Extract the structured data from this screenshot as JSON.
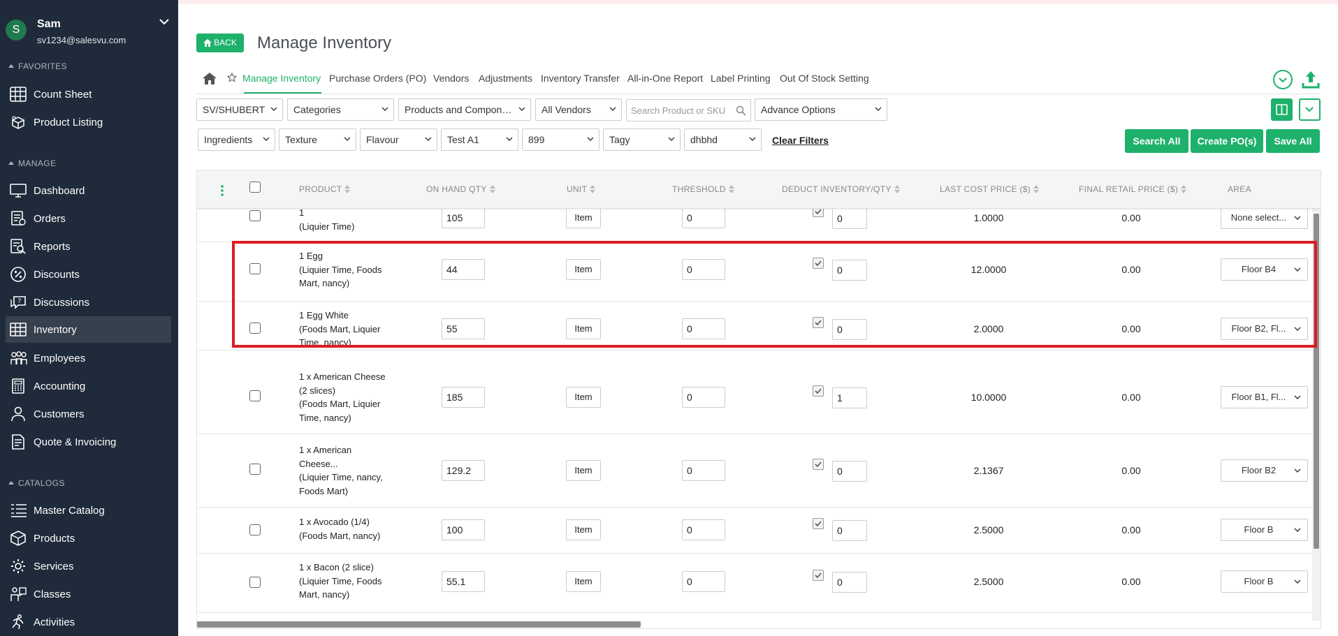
{
  "user": {
    "initial": "S",
    "name": "Sam",
    "email": "sv1234@salesvu.com"
  },
  "sidebar": {
    "favorites_label": "FAVORITES",
    "favorites": [
      {
        "label": "Count Sheet",
        "icon": "grid-table-icon"
      },
      {
        "label": "Product Listing",
        "icon": "boxes-icon"
      }
    ],
    "manage_label": "MANAGE",
    "manage": [
      {
        "label": "Dashboard",
        "icon": "monitor-icon"
      },
      {
        "label": "Orders",
        "icon": "receipt-icon"
      },
      {
        "label": "Reports",
        "icon": "report-icon"
      },
      {
        "label": "Discounts",
        "icon": "percent-icon"
      },
      {
        "label": "Discussions",
        "icon": "chat-icon"
      },
      {
        "label": "Inventory",
        "icon": "inventory-icon",
        "active": true
      },
      {
        "label": "Employees",
        "icon": "people-icon"
      },
      {
        "label": "Accounting",
        "icon": "calculator-icon"
      },
      {
        "label": "Customers",
        "icon": "customer-icon"
      },
      {
        "label": "Quote & Invoicing",
        "icon": "invoice-icon"
      }
    ],
    "catalogs_label": "CATALOGS",
    "catalogs": [
      {
        "label": "Master Catalog",
        "icon": "list-icon"
      },
      {
        "label": "Products",
        "icon": "box-icon"
      },
      {
        "label": "Services",
        "icon": "gear-icon"
      },
      {
        "label": "Classes",
        "icon": "classes-icon"
      },
      {
        "label": "Activities",
        "icon": "activity-icon"
      }
    ]
  },
  "header": {
    "back_label": "BACK",
    "title": "Manage Inventory"
  },
  "tabs": [
    {
      "label": "Manage Inventory",
      "active": true
    },
    {
      "label": "Purchase Orders (PO)"
    },
    {
      "label": "Vendors"
    },
    {
      "label": "Adjustments"
    },
    {
      "label": "Inventory Transfer"
    },
    {
      "label": "All-in-One Report"
    },
    {
      "label": "Label Printing"
    },
    {
      "label": "Out Of Stock Setting"
    }
  ],
  "filters": {
    "location": "SV/SHUBERT",
    "categories": "Categories",
    "products": "Products and Compone...",
    "vendors": "All Vendors",
    "search_placeholder": "Search Product or SKU",
    "advance": "Advance Options",
    "ingredients": "Ingredients",
    "texture": "Texture",
    "flavour": "Flavour",
    "test": "Test A1",
    "num": "899",
    "tagy": "Tagy",
    "dhbhd": "dhbhd",
    "clear": "Clear Filters"
  },
  "actions": {
    "search_all": "Search All",
    "create_po": "Create PO(s)",
    "save_all": "Save All"
  },
  "columns": {
    "product": "PRODUCT",
    "onhand": "ON HAND QTY",
    "unit": "UNIT",
    "threshold": "THRESHOLD",
    "deduct": "DEDUCT INVENTORY/QTY",
    "lastcost": "LAST COST PRICE ($)",
    "retail": "FINAL RETAIL PRICE ($)",
    "area": "AREA"
  },
  "rows": [
    {
      "name": "1",
      "cats": "(Liquier Time)",
      "onhand": "105",
      "unit": "Item",
      "threshold": "0",
      "deduct": "0",
      "lastcost": "1.0000",
      "retail": "0.00",
      "area": "None select..."
    },
    {
      "name": "1 Egg",
      "cats": "(Liquier Time, Foods Mart, nancy)",
      "onhand": "44",
      "unit": "Item",
      "threshold": "0",
      "deduct": "0",
      "lastcost": "12.0000",
      "retail": "0.00",
      "area": "Floor B4"
    },
    {
      "name": "1 Egg White",
      "cats": "(Foods Mart, Liquier Time, nancy)",
      "onhand": "55",
      "unit": "Item",
      "threshold": "0",
      "deduct": "0",
      "lastcost": "2.0000",
      "retail": "0.00",
      "area": "Floor B2, Fl..."
    },
    {
      "name": "1 x American Cheese (2 slices)",
      "cats": "(Foods Mart, Liquier Time, nancy)",
      "onhand": "185",
      "unit": "Item",
      "threshold": "0",
      "deduct": "1",
      "lastcost": "10.0000",
      "retail": "0.00",
      "area": "Floor B1, Fl..."
    },
    {
      "name": "1 x American Cheese...",
      "cats": "(Liquier Time, nancy, Foods Mart)",
      "onhand": "129.2",
      "unit": "Item",
      "threshold": "0",
      "deduct": "0",
      "lastcost": "2.1367",
      "retail": "0.00",
      "area": "Floor B2"
    },
    {
      "name": "1 x Avocado (1/4)",
      "cats": "(Foods Mart, nancy)",
      "onhand": "100",
      "unit": "Item",
      "threshold": "0",
      "deduct": "0",
      "lastcost": "2.5000",
      "retail": "0.00",
      "area": "Floor B"
    },
    {
      "name": "1 x Bacon (2 slice)",
      "cats": "(Liquier Time, Foods Mart, nancy)",
      "onhand": "55.1",
      "unit": "Item",
      "threshold": "0",
      "deduct": "0",
      "lastcost": "2.5000",
      "retail": "0.00",
      "area": "Floor B"
    }
  ],
  "colors": {
    "accent": "#1eb16b",
    "sidebar": "#1f2a3a",
    "highlight": "#e01b24"
  }
}
